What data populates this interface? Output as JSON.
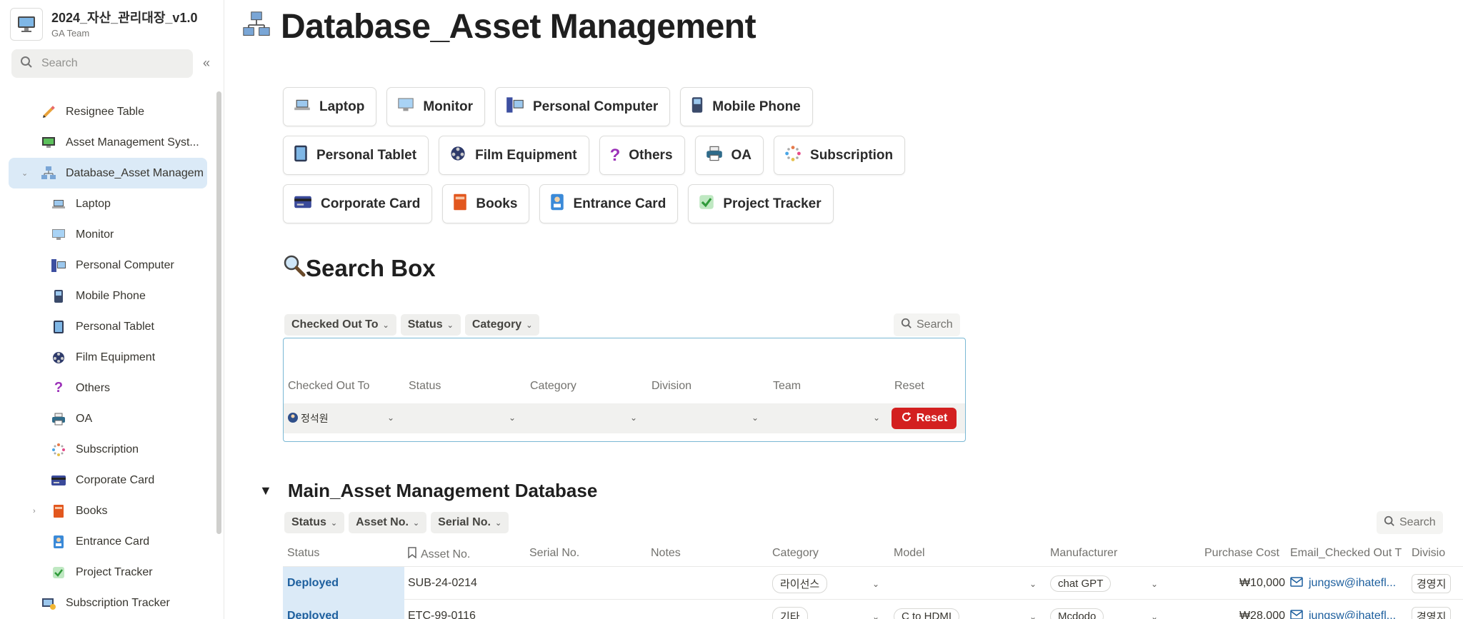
{
  "workspace": {
    "title": "2024_자산_관리대장_v1.0",
    "subtitle": "GA Team",
    "icon": "desktop-computer-icon"
  },
  "sidebar": {
    "search_placeholder": "Search",
    "items": [
      {
        "label": "Resignee Table",
        "icon": "pencil-icon"
      },
      {
        "label": "Asset Management Syst...",
        "icon": "monitor-screen-icon"
      },
      {
        "label": "Database_Asset Managem",
        "icon": "network-computers-icon"
      },
      {
        "label": "Laptop",
        "icon": "laptop-icon"
      },
      {
        "label": "Monitor",
        "icon": "monitor-icon"
      },
      {
        "label": "Personal Computer",
        "icon": "desktop-tower-icon"
      },
      {
        "label": "Mobile Phone",
        "icon": "mobile-phone-icon"
      },
      {
        "label": "Personal Tablet",
        "icon": "tablet-icon"
      },
      {
        "label": "Film Equipment",
        "icon": "film-reel-icon"
      },
      {
        "label": "Others",
        "icon": "question-mark-icon"
      },
      {
        "label": "OA",
        "icon": "printer-icon"
      },
      {
        "label": "Subscription",
        "icon": "sparkle-icon"
      },
      {
        "label": "Corporate Card",
        "icon": "credit-card-icon"
      },
      {
        "label": "Books",
        "icon": "book-icon"
      },
      {
        "label": "Entrance Card",
        "icon": "id-badge-icon"
      },
      {
        "label": "Project Tracker",
        "icon": "check-box-icon"
      },
      {
        "label": "Subscription Tracker",
        "icon": "subscription-tracker-icon"
      }
    ]
  },
  "page": {
    "title": "Database_Asset Management",
    "icon": "network-computers-icon"
  },
  "category_buttons": [
    [
      {
        "label": "Laptop",
        "icon": "laptop-icon"
      },
      {
        "label": "Monitor",
        "icon": "monitor-icon"
      },
      {
        "label": "Personal Computer",
        "icon": "desktop-tower-icon"
      },
      {
        "label": "Mobile Phone",
        "icon": "mobile-phone-icon"
      }
    ],
    [
      {
        "label": "Personal Tablet",
        "icon": "tablet-icon"
      },
      {
        "label": "Film Equipment",
        "icon": "film-reel-icon"
      },
      {
        "label": "Others",
        "icon": "question-mark-icon"
      },
      {
        "label": "OA",
        "icon": "printer-icon"
      },
      {
        "label": "Subscription",
        "icon": "sparkle-icon"
      }
    ],
    [
      {
        "label": "Corporate Card",
        "icon": "credit-card-icon"
      },
      {
        "label": "Books",
        "icon": "book-icon"
      },
      {
        "label": "Entrance Card",
        "icon": "id-badge-icon"
      },
      {
        "label": "Project Tracker",
        "icon": "check-box-icon"
      }
    ]
  ],
  "search_box": {
    "heading": "Search Box",
    "heading_icon": "magnifier-icon",
    "filters": [
      "Checked Out To",
      "Status",
      "Category"
    ],
    "search_label": "Search",
    "columns": [
      "Checked Out To",
      "Status",
      "Category",
      "Division",
      "Team",
      "Reset"
    ],
    "checked_out_to_value": "정석원",
    "reset_label": "Reset"
  },
  "main_db": {
    "heading": "Main_Asset Management Database",
    "filters": [
      "Status",
      "Asset No.",
      "Serial No."
    ],
    "search_label": "Search",
    "columns": [
      "Status",
      "Asset No.",
      "Serial No.",
      "Notes",
      "Category",
      "Model",
      "Manufacturer",
      "Purchase Cost",
      "Email_Checked Out T",
      "Divisio"
    ],
    "rows": [
      {
        "status": "Deployed",
        "asset_no": "SUB-24-0214",
        "serial_no": "",
        "notes": "",
        "category": "라이선스",
        "model": "",
        "manufacturer": "chat GPT",
        "purchase_cost": "₩10,000",
        "email": "jungsw@ihatefl...",
        "division": "경영지"
      },
      {
        "status": "Deployed",
        "asset_no": "ETC-99-0116",
        "serial_no": "",
        "notes": "",
        "category": "기타",
        "model": "C to HDMI",
        "manufacturer": "Mcdodo",
        "purchase_cost": "₩28,000",
        "email": "jungsw@ihatefl...",
        "division": "경영지"
      }
    ]
  },
  "colors": {
    "selected_bg": "#dbeaf7",
    "reset_red": "#d32020",
    "status_blue": "#1d5f9e",
    "search_box_border": "#7ab8d4"
  }
}
